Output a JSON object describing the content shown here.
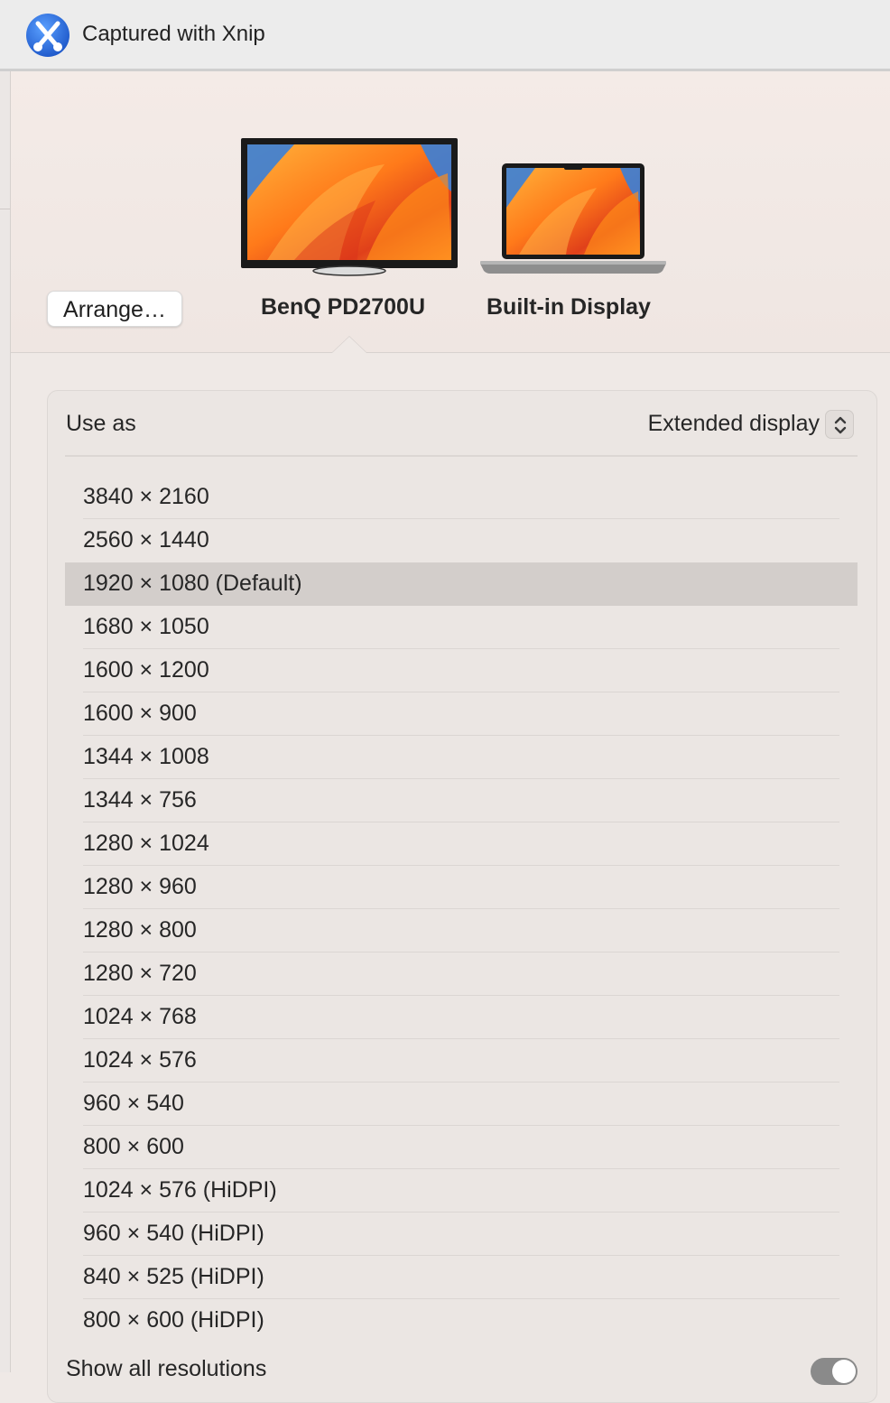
{
  "titlebar": {
    "title": "Captured with Xnip",
    "logo_icon": "xnip-logo-icon"
  },
  "header": {
    "arrange_label": "Arrange…",
    "displays": [
      {
        "name": "BenQ PD2700U",
        "icon": "external-monitor-icon",
        "selected": true
      },
      {
        "name": "Built-in Display",
        "icon": "laptop-icon",
        "selected": false
      }
    ]
  },
  "use_as": {
    "label": "Use as",
    "value": "Extended display"
  },
  "resolutions": [
    {
      "label": "3840 × 2160"
    },
    {
      "label": "2560 × 1440"
    },
    {
      "label": "1920 × 1080 (Default)",
      "selected": true
    },
    {
      "label": "1680 × 1050"
    },
    {
      "label": "1600 × 1200"
    },
    {
      "label": "1600 × 900"
    },
    {
      "label": "1344 × 1008"
    },
    {
      "label": "1344 × 756"
    },
    {
      "label": "1280 × 1024"
    },
    {
      "label": "1280 × 960"
    },
    {
      "label": "1280 × 800"
    },
    {
      "label": "1280 × 720"
    },
    {
      "label": "1024 × 768"
    },
    {
      "label": "1024 × 576"
    },
    {
      "label": "960 × 540"
    },
    {
      "label": "800 × 600"
    },
    {
      "label": "1024 × 576 (HiDPI)"
    },
    {
      "label": "960 × 540 (HiDPI)"
    },
    {
      "label": "840 × 525 (HiDPI)"
    },
    {
      "label": "800 × 600 (HiDPI)"
    }
  ],
  "show_all": {
    "label": "Show all resolutions",
    "enabled": true
  },
  "colors": {
    "selection": "#d3cecb",
    "toggle": "#8a8a8a",
    "xnip_blue": "#2a6fe0"
  }
}
